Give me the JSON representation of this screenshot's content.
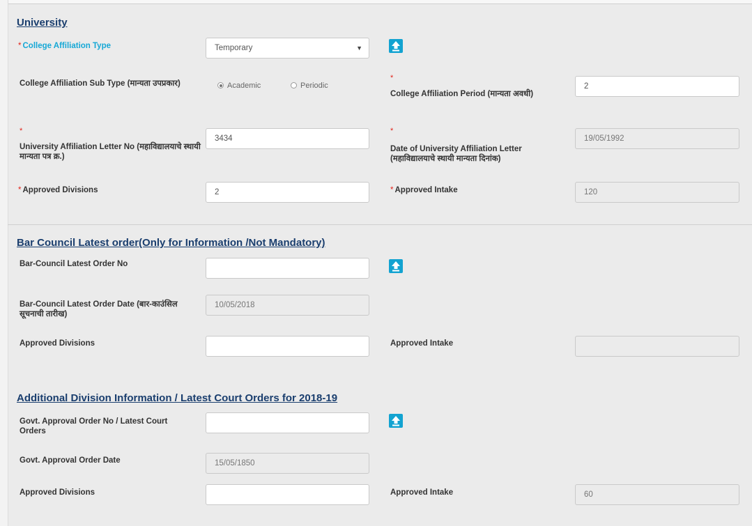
{
  "university": {
    "title": "University",
    "affiliation_type": {
      "label": "College Affiliation Type",
      "value": "Temporary",
      "arrow": "▼"
    },
    "sub_type": {
      "label": "College Affiliation Sub Type (मान्यता उपप्रकार)",
      "options": [
        "Academic",
        "Periodic"
      ],
      "selected": "Academic"
    },
    "period": {
      "label": "College Affiliation Period (मान्यता अवधी)",
      "value": "2"
    },
    "letter_no": {
      "label": "University Affiliation Letter No (महाविद्यालयाचे स्थायी मान्यता पत्र क्र.)",
      "value": "3434"
    },
    "letter_date": {
      "label": "Date of University Affiliation Letter (महाविद्यालयाचे स्थायी मान्यता दिनांक)",
      "value": "19/05/1992"
    },
    "divisions": {
      "label": "Approved Divisions",
      "value": "2"
    },
    "intake": {
      "label": "Approved Intake",
      "value": "120"
    }
  },
  "bar_council": {
    "title": "Bar Council Latest order(Only for Information /Not Mandatory)",
    "order_no": {
      "label": "Bar-Council Latest Order No",
      "value": ""
    },
    "order_date": {
      "label": "Bar-Council Latest Order Date (बार-काउंसिल सूचनाची तारीख)",
      "value": "10/05/2018"
    },
    "divisions": {
      "label": "Approved Divisions",
      "value": ""
    },
    "intake": {
      "label": "Approved Intake",
      "value": ""
    }
  },
  "additional": {
    "title": "Additional Division Information / Latest Court Orders for 2018-19",
    "order_no": {
      "label": "Govt. Approval Order No / Latest Court Orders",
      "value": ""
    },
    "order_date": {
      "label": "Govt. Approval Order Date",
      "value": "15/05/1850"
    },
    "divisions": {
      "label": "Approved Divisions",
      "value": ""
    },
    "intake": {
      "label": "Approved Intake",
      "value": "60"
    }
  },
  "required_marker": "*",
  "icons": {
    "upload": "upload-arrow-icon",
    "dropdown": "chevron-down-icon"
  },
  "colors": {
    "section_title": "#1a3e6e",
    "required": "#e2231a",
    "highlight_label": "#16a8d6",
    "upload_button": "#13a3d1"
  }
}
